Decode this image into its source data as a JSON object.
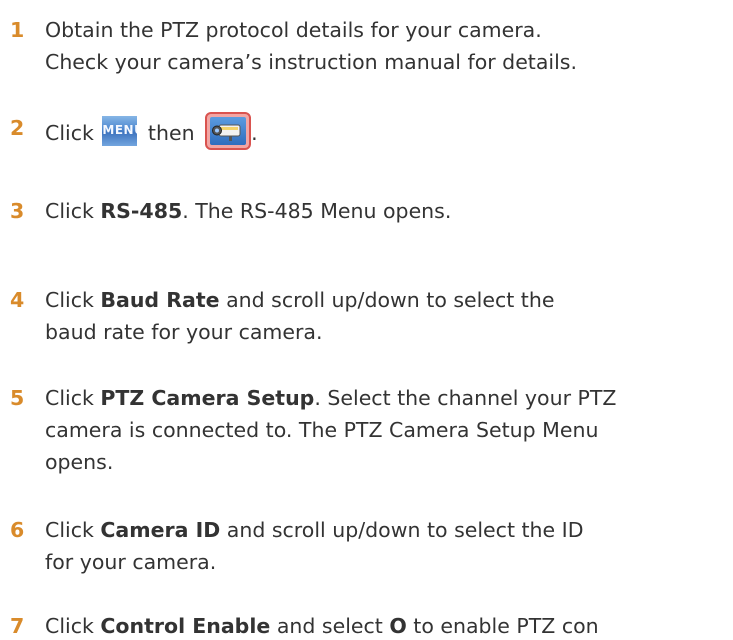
{
  "steps": [
    {
      "number": "1",
      "lines": [
        "Obtain the PTZ protocol details for your camera.",
        "Check your camera’s instruction manual for details."
      ]
    },
    {
      "number": "2",
      "text_click": "Click",
      "menu_icon_text": "MENU",
      "text_then": "then",
      "text_end": ".",
      "icons": [
        "menu-icon",
        "camera-icon"
      ]
    },
    {
      "number": "3",
      "before": "Click ",
      "bold": "RS-485",
      "after": ". The RS-485 Menu opens."
    },
    {
      "number": "4",
      "before": "Click ",
      "bold": "Baud Rate",
      "after": " and scroll up/down to select the",
      "line2": "baud rate for your camera."
    },
    {
      "number": "5",
      "before": "Click ",
      "bold": "PTZ Camera Setup",
      "after": ". Select the channel your PTZ",
      "line2": "camera is connected to. The PTZ Camera Setup Menu",
      "line3": "opens."
    },
    {
      "number": "6",
      "before": "Click ",
      "bold": "Camera ID",
      "after": " and scroll up/down to select the ID",
      "line2": "for your camera."
    },
    {
      "number": "7",
      "before": "Click ",
      "bold": "Control Enable",
      "middle": " and select ",
      "bold2": "O",
      "after": " to enable PTZ con"
    }
  ],
  "colors": {
    "step_number": "#d98b2b",
    "body_text": "#333333",
    "camera_icon_border": "#d9534f"
  }
}
